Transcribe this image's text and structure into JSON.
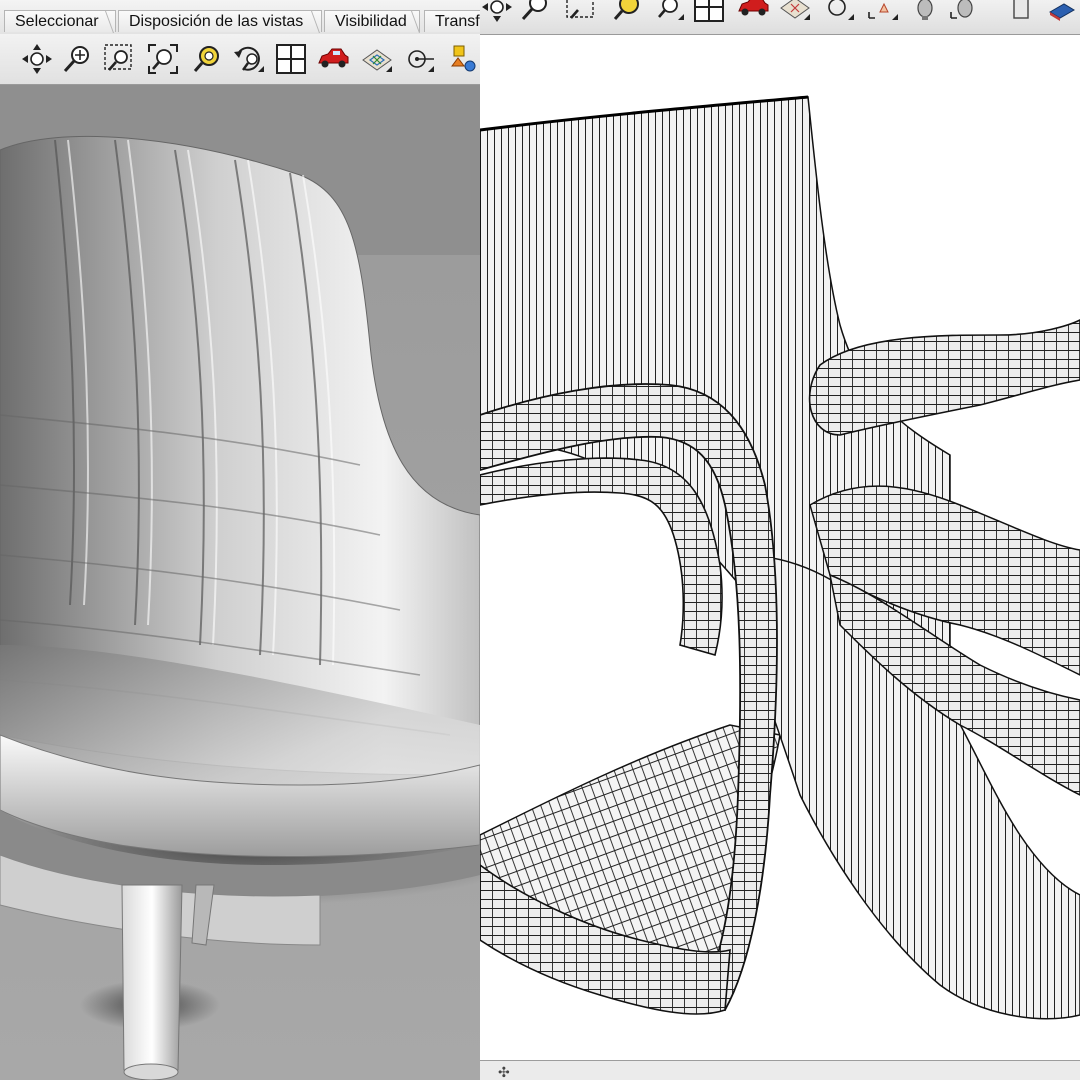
{
  "left": {
    "tabs": [
      {
        "label": "Seleccionar"
      },
      {
        "label": "Disposición de las vistas"
      },
      {
        "label": "Visibilidad"
      },
      {
        "label": "Transf"
      }
    ],
    "tools": [
      {
        "icon": "pan-icon"
      },
      {
        "icon": "zoom-icon"
      },
      {
        "icon": "zoom-window-icon"
      },
      {
        "icon": "zoom-extents-icon"
      },
      {
        "icon": "zoom-selected-icon"
      },
      {
        "icon": "undo-view-icon"
      },
      {
        "icon": "four-viewports-icon"
      },
      {
        "icon": "car-render-icon"
      },
      {
        "icon": "properties-icon"
      },
      {
        "icon": "snap-icon"
      },
      {
        "icon": "object-layers-icon"
      }
    ],
    "viewport_background": "#a4a4a4"
  },
  "right": {
    "tools": [
      {
        "icon": "pan-icon"
      },
      {
        "icon": "zoom-icon"
      },
      {
        "icon": "zoom-window-icon"
      },
      {
        "icon": "zoom-selected-icon"
      },
      {
        "icon": "zoom-extents-icon"
      },
      {
        "icon": "four-viewports-icon"
      },
      {
        "icon": "car-render-icon"
      },
      {
        "icon": "properties-icon"
      },
      {
        "icon": "snap-icon"
      },
      {
        "icon": "grid-icon"
      },
      {
        "icon": "light-icon"
      },
      {
        "icon": "light-icon"
      },
      {
        "icon": "file-icon"
      },
      {
        "icon": "book-icon"
      }
    ],
    "status_icon": "plus-icon"
  }
}
